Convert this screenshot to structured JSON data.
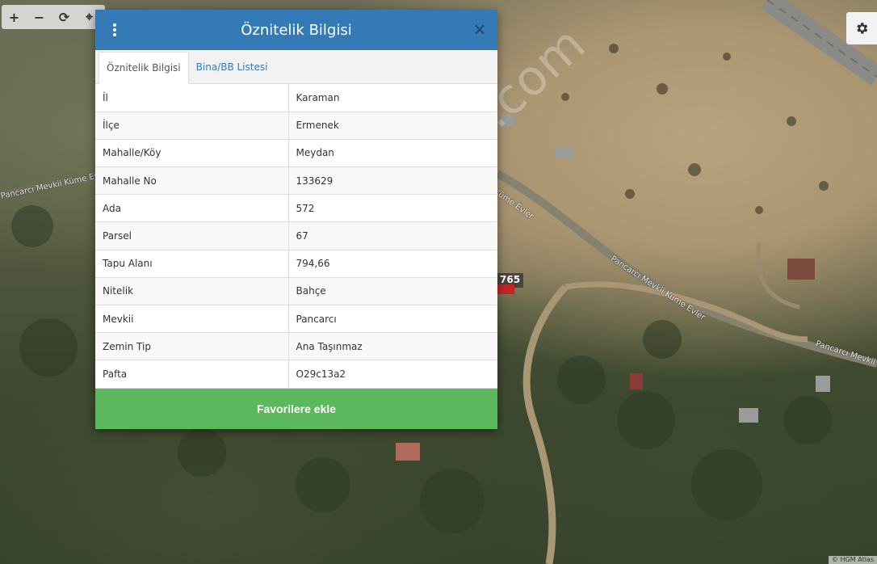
{
  "map": {
    "toolbar": {
      "zoom_in": "+",
      "zoom_out": "−",
      "refresh": "⟳",
      "locate": "⌖"
    },
    "parcel_label": "765",
    "road_labels": [
      "Pancarcı Mevkii Küme Evler",
      "Pancarcı Mevkii Küme Evler",
      "Küme Evler",
      "Pancarcı Mevkii"
    ],
    "watermark": "emlakjet.com",
    "attribution": "© HGM Atlas"
  },
  "modal": {
    "title": "Öznitelik Bilgisi",
    "close_symbol": "×",
    "tabs": [
      {
        "label": "Öznitelik Bilgisi",
        "active": true
      },
      {
        "label": "Bina/BB Listesi",
        "active": false
      }
    ],
    "rows": [
      {
        "key": "İl",
        "value": "Karaman"
      },
      {
        "key": "İlçe",
        "value": "Ermenek"
      },
      {
        "key": "Mahalle/Köy",
        "value": "Meydan"
      },
      {
        "key": "Mahalle No",
        "value": "133629"
      },
      {
        "key": "Ada",
        "value": "572"
      },
      {
        "key": "Parsel",
        "value": "67"
      },
      {
        "key": "Tapu Alanı",
        "value": "794,66"
      },
      {
        "key": "Nitelik",
        "value": "Bahçe"
      },
      {
        "key": "Mevkii",
        "value": "Pancarcı"
      },
      {
        "key": "Zemin Tip",
        "value": "Ana Taşınmaz"
      },
      {
        "key": "Pafta",
        "value": "O29c13a2"
      }
    ],
    "favorite_button": "Favorilere ekle"
  },
  "colors": {
    "header": "#337ab7",
    "favorite_button": "#5cb85c",
    "tab_link": "#337ab7"
  },
  "icons": {
    "menu": "vertical-dots-icon",
    "settings": "gear-icon"
  }
}
